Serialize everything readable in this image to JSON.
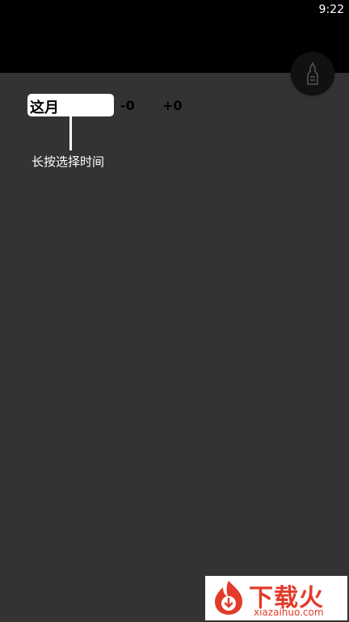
{
  "status_bar": {
    "time": "9:22"
  },
  "month_selector": {
    "label": "这月",
    "minus_label": "-0",
    "plus_label": "+0"
  },
  "hint": {
    "text": "长按选择时间"
  },
  "fab": {
    "icon": "bottle-icon"
  },
  "watermark": {
    "title": "下载火",
    "url": "xiazaihuo.com"
  },
  "colors": {
    "background": "#333333",
    "status_bar": "#000000",
    "watermark_red": "#e23b2b"
  }
}
